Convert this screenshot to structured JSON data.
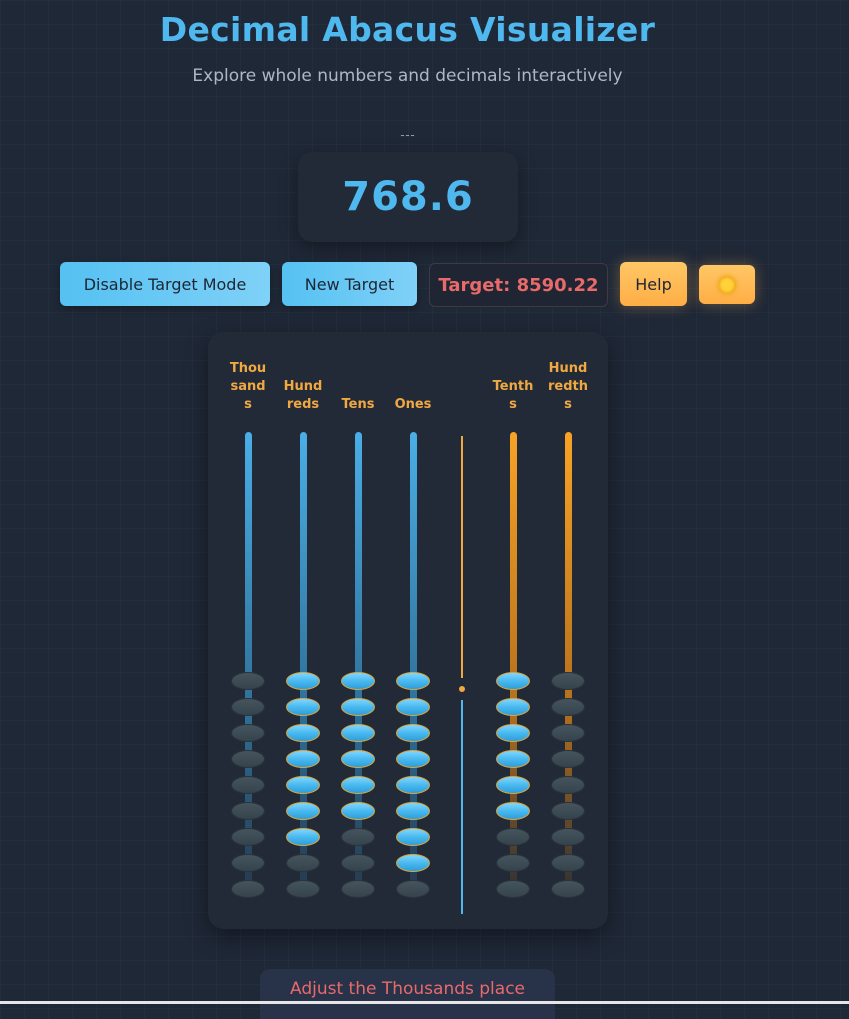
{
  "header": {
    "title": "Decimal Abacus Visualizer",
    "subtitle": "Explore whole numbers and decimals interactively",
    "spinner_glyph": "˷˷˷"
  },
  "display": {
    "value": "768.6"
  },
  "toolbar": {
    "target_mode_label": "Disable Target Mode",
    "new_target_label": "New Target",
    "target_text": "Target: 8590.22",
    "help_label": "Help",
    "theme_icon": "sun-icon"
  },
  "abacus": {
    "columns": [
      {
        "label": "Thou\nsand\ns",
        "place": "Thousands",
        "beads_up": 0,
        "total_beads": 9,
        "rod_color": "blue"
      },
      {
        "label": "Hund\nreds",
        "place": "Hundreds",
        "beads_up": 7,
        "total_beads": 9,
        "rod_color": "blue"
      },
      {
        "label": "Tens",
        "place": "Tens",
        "beads_up": 6,
        "total_beads": 9,
        "rod_color": "blue"
      },
      {
        "label": "Ones",
        "place": "Ones",
        "beads_up": 8,
        "total_beads": 9,
        "rod_color": "blue"
      },
      {
        "label": "Tenth\ns",
        "place": "Tenths",
        "beads_up": 6,
        "total_beads": 9,
        "rod_color": "orange"
      },
      {
        "label": "Hund\nredth\ns",
        "place": "Hundredths",
        "beads_up": 0,
        "total_beads": 9,
        "rod_color": "orange"
      }
    ],
    "colors": {
      "bead_active": "#4fb8ee",
      "bead_inactive": "#3a4850",
      "label": "#f0a840",
      "divider": "#f0a840"
    }
  },
  "hint": {
    "text": "Adjust the Thousands place"
  },
  "colors": {
    "accent": "#4fb8ee",
    "target": "#e86a6a",
    "amber": "#ffb74d",
    "background": "#1f2837"
  }
}
